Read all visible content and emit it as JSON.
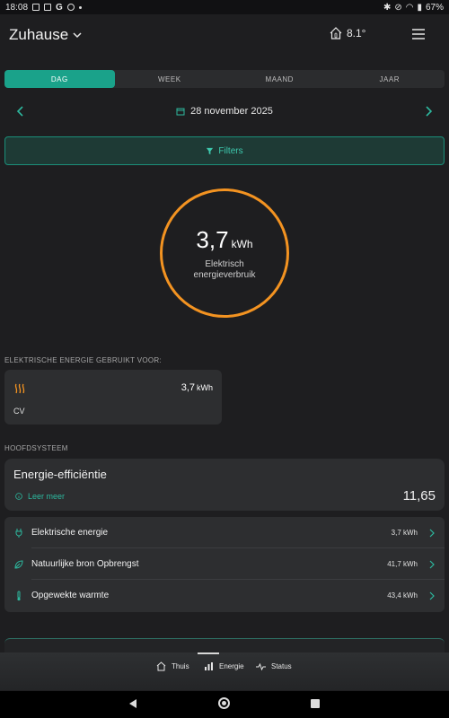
{
  "status_bar": {
    "time": "18:08",
    "battery": "67%"
  },
  "header": {
    "title": "Zuhause",
    "temperature": "8.1°"
  },
  "period_tabs": [
    "DAG",
    "WEEK",
    "MAAND",
    "JAAR"
  ],
  "active_tab": "DAG",
  "date": "28 november 2025",
  "filters_label": "Filters",
  "gauge": {
    "value": "3,7",
    "unit": "kWh",
    "label": "Elektrisch energieverbruik",
    "ring_color": "#f39321"
  },
  "used_for": {
    "heading": "ELEKTRISCHE ENERGIE GEBRUIKT VOOR:",
    "card": {
      "name": "CV",
      "value": "3,7",
      "unit": "kWh",
      "icon": "heating-icon"
    }
  },
  "main_system": {
    "heading": "HOOFDSYSTEEM",
    "efficiency": {
      "title": "Energie-efficiëntie",
      "learn_more": "Leer meer",
      "value": "11,65"
    },
    "rows": [
      {
        "label": "Elektrische energie",
        "value": "3,7 kWh",
        "icon": "plug-icon"
      },
      {
        "label": "Natuurlijke bron Opbrengst",
        "value": "41,7 kWh",
        "icon": "leaf-icon"
      },
      {
        "label": "Opgewekte warmte",
        "value": "43,4 kWh",
        "icon": "thermometer-icon"
      }
    ]
  },
  "bottom_nav": [
    {
      "label": "Thuis",
      "icon": "home-icon"
    },
    {
      "label": "Energie",
      "icon": "bar-chart-icon",
      "active": true
    },
    {
      "label": "Status",
      "icon": "pulse-icon"
    }
  ],
  "colors": {
    "accent": "#1aa28a",
    "accent_text": "#2db89e",
    "orange": "#f39321",
    "background": "#1e1e20",
    "card": "#2d2e30"
  }
}
